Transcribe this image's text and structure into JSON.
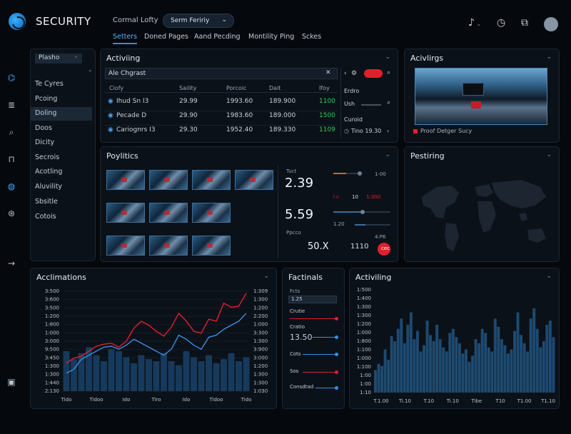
{
  "app": {
    "title": "SECURITY",
    "breadcrumb": "Cormal Lofty",
    "selector": "Serm Feririy"
  },
  "nav_tabs": [
    "Setters",
    "Doned Pages",
    "Aand Pecding",
    "Montility Ping",
    "Sckes"
  ],
  "sidebar": {
    "header": "Plasho",
    "items": [
      "Te Cyres",
      "Pcoing",
      "Doling",
      "Doos",
      "Dicity",
      "Secrois",
      "Acotling",
      "Aluvility",
      "Sbsitle",
      "Cotois"
    ],
    "selected": 2
  },
  "activity_panel": {
    "title": "Activiing",
    "search_placeholder": "Ale Chgrast",
    "columns": [
      "Ciofy",
      "Saility",
      "Porcoic",
      "Dait",
      "Ifoy"
    ],
    "rows": [
      [
        "Ihud Sn I3",
        "29.99",
        "1993.60",
        "189.900",
        "1100"
      ],
      [
        "Pecade D",
        "29.90",
        "1983.60",
        "189.000",
        "1500"
      ],
      [
        "Cariognrs I3",
        "29.30",
        "1952.40",
        "189.330",
        "1109"
      ]
    ],
    "side_title": "Erdro",
    "side_labels": [
      "Ush",
      "Curoid"
    ],
    "side_value": "Tino 19.30"
  },
  "activity_cam": {
    "title": "Acivlirgs",
    "caption": "Proof Detger Sucy"
  },
  "profiles": {
    "title": "Poylitics",
    "stat_label": "Tuct",
    "stat1": "2.39",
    "stat2": "5.59",
    "stat3": "50.X",
    "stat4": "1110",
    "stat_label2": "Ppcco",
    "slider_labels": [
      "1-00",
      "l.c",
      "10",
      "1:300",
      "1.20",
      "4:P6"
    ],
    "slider_values": [
      0.45,
      0.5,
      0.3
    ],
    "pill_label": "cec"
  },
  "pestiring": {
    "title": "Pestiring"
  },
  "acclimations": {
    "title": "Acclimations",
    "y_left": [
      "3:500",
      "3:600",
      "3:500",
      "1:200",
      "1:800",
      "1:000",
      "3:000",
      "9:500",
      "3:450",
      "1:300",
      "1:300",
      "1:440",
      "2:130"
    ],
    "y_right": [
      "1:309",
      "1:300",
      "1:200",
      "2:200",
      "1:000",
      "3:300",
      "1:300",
      "3:900",
      "3:000",
      "1:200",
      "1:300",
      "1:300",
      "1:030"
    ],
    "x_labels": [
      "Tido",
      "Tidoo",
      "Ido",
      "Tiro",
      "Ido",
      "Tidoo",
      "Tido"
    ]
  },
  "factinals": {
    "title": "Factinals",
    "items": [
      "Fcts",
      "Crutie",
      "Cratio",
      "13.50",
      "Cots",
      "Sos",
      "Consdtad"
    ],
    "value": "1.25",
    "line_colors": [
      "#e0202c",
      "#3b8de0",
      "#3b8de0",
      "#e0202c",
      "#3b8de0"
    ]
  },
  "activiling": {
    "title": "Activiling",
    "y_labels": [
      "1:500",
      "1:400",
      "1:300",
      "1:300",
      "1:200",
      "1:000",
      "1:800",
      "1:100",
      "1:000",
      "1:100",
      "1:00",
      "1:00",
      "1:10"
    ],
    "x_labels": [
      "T.1.00",
      "Ti.10",
      "T.10",
      "Ti.10",
      "Tibe",
      "T10",
      "T1.00",
      "T1.10"
    ]
  },
  "colors": {
    "accent": "#2f8be0",
    "danger": "#e0202c",
    "panel": "#0b1119"
  },
  "chart_data": [
    {
      "type": "line",
      "title": "Acclimations",
      "x": [
        0,
        1,
        2,
        3,
        4,
        5,
        6,
        7,
        8,
        9,
        10,
        11,
        12,
        13,
        14,
        15,
        16,
        17,
        18,
        19,
        20,
        21,
        22,
        23,
        24
      ],
      "series": [
        {
          "name": "",
          "values": [
            0.28,
            0.33,
            0.35,
            0.4,
            0.45,
            0.47,
            0.48,
            0.44,
            0.5,
            0.63,
            0.7,
            0.66,
            0.6,
            0.55,
            0.64,
            0.78,
            0.7,
            0.6,
            0.58,
            0.72,
            0.7,
            0.88,
            0.84,
            0.85,
            0.98
          ]
        },
        {
          "name": "",
          "values": [
            0.18,
            0.22,
            0.32,
            0.36,
            0.4,
            0.44,
            0.45,
            0.42,
            0.46,
            0.52,
            0.48,
            0.44,
            0.4,
            0.36,
            0.42,
            0.56,
            0.52,
            0.46,
            0.42,
            0.54,
            0.56,
            0.62,
            0.66,
            0.7,
            0.78
          ]
        },
        {
          "name": "",
          "values": [
            0.4,
            0.32,
            0.38,
            0.44,
            0.36,
            0.3,
            0.42,
            0.4,
            0.34,
            0.28,
            0.36,
            0.32,
            0.3,
            0.38,
            0.3,
            0.26,
            0.4,
            0.34,
            0.3,
            0.36,
            0.28,
            0.32,
            0.38,
            0.3,
            0.34
          ]
        }
      ]
    },
    {
      "type": "bar",
      "title": "Activiling",
      "values": [
        0.22,
        0.28,
        0.26,
        0.42,
        0.32,
        0.55,
        0.5,
        0.62,
        0.72,
        0.48,
        0.66,
        0.78,
        0.52,
        0.6,
        0.4,
        0.46,
        0.7,
        0.56,
        0.5,
        0.66,
        0.52,
        0.44,
        0.4,
        0.58,
        0.62,
        0.54,
        0.48,
        0.38,
        0.42,
        0.3,
        0.36,
        0.52,
        0.48,
        0.62,
        0.58,
        0.44,
        0.4,
        0.72,
        0.64,
        0.52,
        0.46,
        0.38,
        0.42,
        0.6,
        0.78,
        0.56,
        0.48,
        0.4,
        0.72,
        0.82,
        0.62,
        0.44,
        0.5,
        0.66,
        0.7,
        0.54
      ]
    }
  ]
}
